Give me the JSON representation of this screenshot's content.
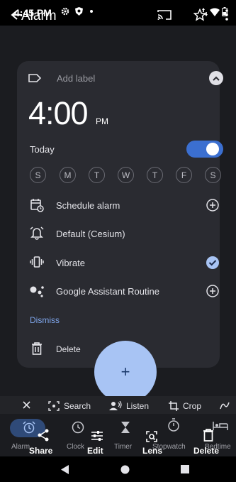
{
  "status_bar": {
    "time": "4:45 PM"
  },
  "app_bar": {
    "title": "Alarm"
  },
  "alarm": {
    "label_placeholder": "Add label",
    "time": "4:00",
    "ampm": "PM",
    "day_text": "Today",
    "enabled": true,
    "days": [
      "S",
      "M",
      "T",
      "W",
      "T",
      "F",
      "S"
    ],
    "options": {
      "schedule": "Schedule alarm",
      "sound": "Default (Cesium)",
      "vibrate": "Vibrate",
      "assistant": "Google Assistant Routine"
    },
    "dismiss": "Dismiss",
    "delete": "Delete"
  },
  "fab": {
    "label": "+"
  },
  "lens_bar": {
    "search": "Search",
    "listen": "Listen",
    "crop": "Crop"
  },
  "nav": {
    "alarm": "Alarm",
    "clock": "Clock",
    "timer": "Timer",
    "stopwatch": "Stopwatch",
    "bedtime": "Bedtime"
  },
  "overlay_actions": {
    "share": "Share",
    "edit": "Edit",
    "lens": "Lens",
    "delete": "Delete"
  },
  "colors": {
    "accent": "#3b6fd0",
    "fab": "#a8c4f4",
    "card": "#2a2b31",
    "link": "#7fa6ec"
  }
}
